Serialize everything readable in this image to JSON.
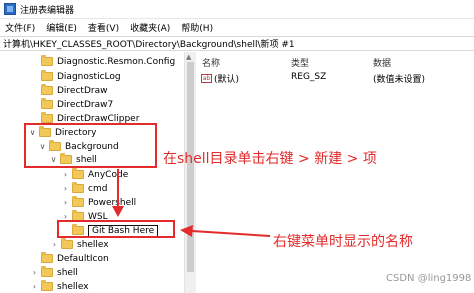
{
  "window": {
    "title": "注册表编辑器"
  },
  "menu": [
    "文件(F)",
    "编辑(E)",
    "查看(V)",
    "收藏夹(A)",
    "帮助(H)"
  ],
  "address": "计算机\\HKEY_CLASSES_ROOT\\Directory\\Background\\shell\\新项 #1",
  "tree": {
    "items": [
      {
        "label": "Diagnostic.Resmon.Config",
        "expander": ""
      },
      {
        "label": "DiagnosticLog",
        "expander": ""
      },
      {
        "label": "DirectDraw",
        "expander": ""
      },
      {
        "label": "DirectDraw7",
        "expander": ""
      },
      {
        "label": "DirectDrawClipper",
        "expander": ""
      },
      {
        "label": "Directory",
        "expander": "∨"
      },
      {
        "label": "Background",
        "expander": "∨"
      },
      {
        "label": "shell",
        "expander": "∨"
      },
      {
        "label": "AnyCode",
        "expander": "›"
      },
      {
        "label": "cmd",
        "expander": "›"
      },
      {
        "label": "Powershell",
        "expander": "›"
      },
      {
        "label": "WSL",
        "expander": "›"
      },
      {
        "label": "Git Bash Here",
        "expander": ""
      },
      {
        "label": "shellex",
        "expander": "›"
      },
      {
        "label": "DefaultIcon",
        "expander": ""
      },
      {
        "label": "shell",
        "expander": "›"
      },
      {
        "label": "shellex",
        "expander": "›"
      }
    ]
  },
  "list": {
    "headers": {
      "name": "名称",
      "type": "类型",
      "data": "数据"
    },
    "rows": [
      {
        "icon": "ab",
        "name": "(默认)",
        "type": "REG_SZ",
        "data": "(数值未设置)"
      }
    ]
  },
  "annotations": {
    "instruction": "在shell目录单击右键 > 新建 > 项",
    "rename_note": "右键菜单时显示的名称",
    "color": "#e32b2b"
  },
  "watermark": "CSDN @ling1998"
}
